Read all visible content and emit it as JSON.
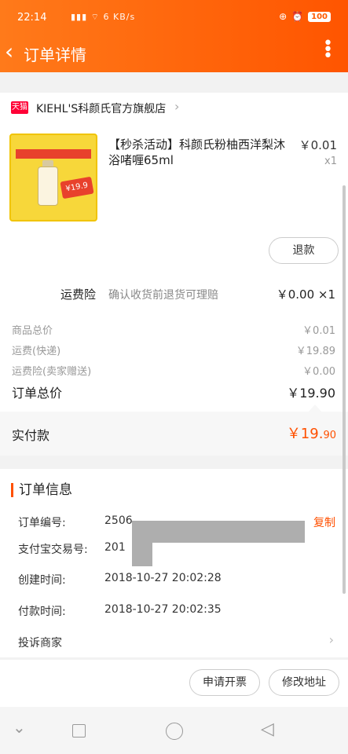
{
  "status_bar": {
    "time": "22:14",
    "network": "6 KB/s",
    "battery": "100"
  },
  "header": {
    "title": "订单详情",
    "back_icon": "chevron-left-icon",
    "more_icon": "more-vertical-icon"
  },
  "shop": {
    "badge": "天猫",
    "name": "KIEHL'S科颜氏官方旗舰店"
  },
  "product": {
    "name": "【秒杀活动】科颜氏粉柚西洋梨沐浴啫喱65ml",
    "price": "￥0.01",
    "qty": "x1",
    "image_badge": "¥19.9"
  },
  "refund_button": "退款",
  "shipping_insurance": {
    "label": "运费险",
    "desc": "确认收货前退货可理赔",
    "value": "￥0.00 ×1"
  },
  "summary": {
    "goods_total_label": "商品总价",
    "goods_total": "￥0.01",
    "shipping_label": "运费(快递)",
    "shipping": "￥19.89",
    "insurance_label": "运费险(卖家赠送)",
    "insurance": "￥0.00",
    "order_total_label": "订单总价",
    "order_total": "￥19.90"
  },
  "paid": {
    "label": "实付款",
    "value_main": "￥19.",
    "value_cents": "90"
  },
  "order_info": {
    "title": "订单信息",
    "order_no_label": "订单编号:",
    "order_no": "2506",
    "copy": "复制",
    "alipay_label": "支付宝交易号:",
    "alipay_no": "201",
    "created_label": "创建时间:",
    "created": "2018-10-27 20:02:28",
    "paid_label": "付款时间:",
    "paid_time": "2018-10-27 20:02:35",
    "complain": "投诉商家"
  },
  "actions": {
    "invoice": "申请开票",
    "change_address": "修改地址"
  },
  "colors": {
    "accent": "#ff5500",
    "price_red": "#ff5000"
  }
}
